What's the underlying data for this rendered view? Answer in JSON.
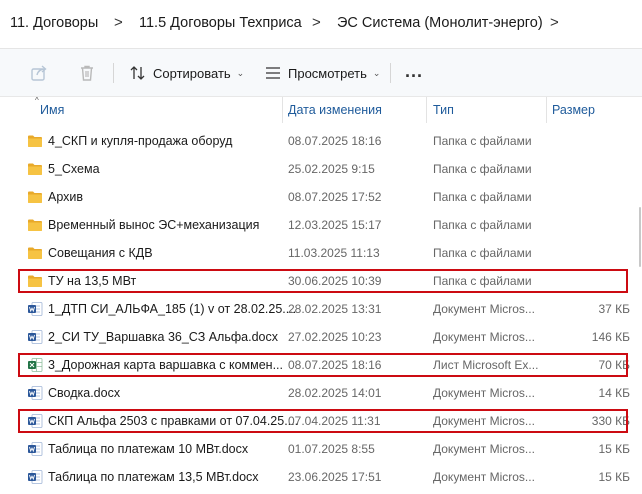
{
  "breadcrumb": {
    "items": [
      "11. Договоры",
      "11.5 Договоры Техприса",
      "ЭС Система (Монолит-энерго)"
    ],
    "separator": ">"
  },
  "toolbar": {
    "sort_label": "Сортировать",
    "view_label": "Просмотреть",
    "more_label": "...",
    "dropdown_glyph": "⌄"
  },
  "columns": {
    "name": "Имя",
    "date": "Дата изменения",
    "type": "Тип",
    "size": "Размер"
  },
  "files": [
    {
      "name": "4_СКП и купля-продажа оборуд",
      "date": "08.07.2025 18:16",
      "type": "Папка с файлами",
      "size": "",
      "icon": "folder-icon",
      "highlighted": false
    },
    {
      "name": "5_Схема",
      "date": "25.02.2025 9:15",
      "type": "Папка с файлами",
      "size": "",
      "icon": "folder-icon",
      "highlighted": false
    },
    {
      "name": "Архив",
      "date": "08.07.2025 17:52",
      "type": "Папка с файлами",
      "size": "",
      "icon": "folder-icon",
      "highlighted": false
    },
    {
      "name": "Временный вынос ЭС+механизация",
      "date": "12.03.2025 15:17",
      "type": "Папка с файлами",
      "size": "",
      "icon": "folder-icon",
      "highlighted": false
    },
    {
      "name": "Совещания с КДВ",
      "date": "11.03.2025 11:13",
      "type": "Папка с файлами",
      "size": "",
      "icon": "folder-icon",
      "highlighted": false
    },
    {
      "name": "ТУ на 13,5 МВт",
      "date": "30.06.2025 10:39",
      "type": "Папка с файлами",
      "size": "",
      "icon": "folder-icon",
      "highlighted": true
    },
    {
      "name": "1_ДТП СИ_АЛЬФА_185 (1) v от 28.02.25....",
      "date": "28.02.2025 13:31",
      "type": "Документ Micros...",
      "size": "37 КБ",
      "icon": "word-doc-icon",
      "highlighted": false
    },
    {
      "name": "2_СИ ТУ_Варшавка 36_СЗ Альфа.docx",
      "date": "27.02.2025 10:23",
      "type": "Документ Micros...",
      "size": "146 КБ",
      "icon": "word-doc-icon",
      "highlighted": false
    },
    {
      "name": "3_Дорожная карта варшавка с коммен...",
      "date": "08.07.2025 18:16",
      "type": "Лист Microsoft Ex...",
      "size": "70 КБ",
      "icon": "excel-sheet-icon",
      "highlighted": true
    },
    {
      "name": "Сводка.docx",
      "date": "28.02.2025 14:01",
      "type": "Документ Micros...",
      "size": "14 КБ",
      "icon": "word-doc-icon",
      "highlighted": false
    },
    {
      "name": "СКП Альфа 2503 с правками от 07.04.25....",
      "date": "07.04.2025 11:31",
      "type": "Документ Micros...",
      "size": "330 КБ",
      "icon": "word-doc-icon",
      "highlighted": true
    },
    {
      "name": "Таблица по платежам 10 МВт.docx",
      "date": "01.07.2025 8:55",
      "type": "Документ Micros...",
      "size": "15 КБ",
      "icon": "word-doc-icon",
      "highlighted": false
    },
    {
      "name": "Таблица по платежам 13,5 МВт.docx",
      "date": "23.06.2025 17:51",
      "type": "Документ Micros...",
      "size": "15 КБ",
      "icon": "word-doc-icon",
      "highlighted": false
    }
  ],
  "colors": {
    "highlight": "#cc0b12",
    "folder": "#f6c343",
    "word": "#2b579a",
    "excel": "#217346",
    "header_text": "#1f5b9b"
  }
}
